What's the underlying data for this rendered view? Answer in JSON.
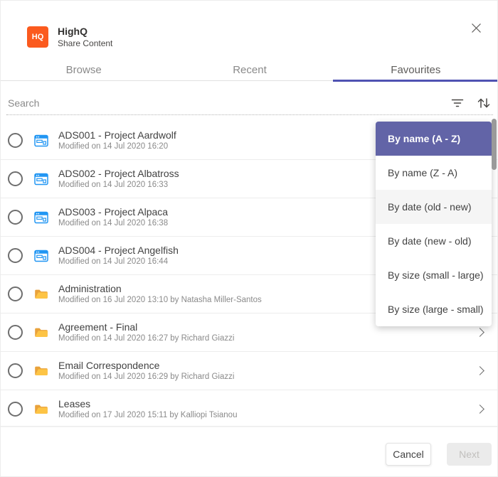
{
  "dialog": {
    "logo_text": "HQ",
    "app_name": "HighQ",
    "subtitle": "Share Content"
  },
  "icons": {
    "close": "close-icon",
    "filter": "filter-icon",
    "sort": "sort-arrows-icon",
    "site": "site-icon",
    "folder": "folder-icon",
    "chevron": "chevron-right-icon"
  },
  "tabs": [
    {
      "label": "Browse",
      "active": false
    },
    {
      "label": "Recent",
      "active": false
    },
    {
      "label": "Favourites",
      "active": true
    }
  ],
  "search": {
    "placeholder": "Search",
    "value": ""
  },
  "list": {
    "items": [
      {
        "type": "site",
        "title": "ADS001 - Project Aardwolf",
        "meta": "Modified on 14 Jul 2020 16:20"
      },
      {
        "type": "site",
        "title": "ADS002 - Project Albatross",
        "meta": "Modified on 14 Jul 2020 16:33"
      },
      {
        "type": "site",
        "title": "ADS003 - Project Alpaca",
        "meta": "Modified on 14 Jul 2020 16:38"
      },
      {
        "type": "site",
        "title": "ADS004 - Project Angelfish",
        "meta": "Modified on 14 Jul 2020 16:44"
      },
      {
        "type": "folder",
        "title": "Administration",
        "meta": "Modified on 16 Jul 2020 13:10 by Natasha Miller-Santos"
      },
      {
        "type": "folder",
        "title": "Agreement - Final",
        "meta": "Modified on 14 Jul 2020 16:27 by Richard Giazzi"
      },
      {
        "type": "folder",
        "title": "Email Correspondence",
        "meta": "Modified on 14 Jul 2020 16:29 by Richard Giazzi"
      },
      {
        "type": "folder",
        "title": "Leases",
        "meta": "Modified on 17 Jul 2020 15:11 by Kalliopi Tsianou"
      }
    ]
  },
  "sort_menu": {
    "items": [
      {
        "label": "By name (A - Z)",
        "state": "selected"
      },
      {
        "label": "By name (Z - A)",
        "state": "normal"
      },
      {
        "label": "By date (old - new)",
        "state": "hover"
      },
      {
        "label": "By date (new - old)",
        "state": "normal"
      },
      {
        "label": "By size (small - large)",
        "state": "normal"
      },
      {
        "label": "By size (large - small)",
        "state": "normal"
      }
    ]
  },
  "footer": {
    "cancel_label": "Cancel",
    "next_label": "Next",
    "next_disabled": true
  },
  "colors": {
    "accent": "#4f52b2",
    "menu_selected_bg": "#6264a7",
    "logo_bg": "#fb5a1e",
    "site_icon": "#2196f3",
    "folder_dark": "#e9a23b",
    "folder_light": "#fdc445"
  }
}
